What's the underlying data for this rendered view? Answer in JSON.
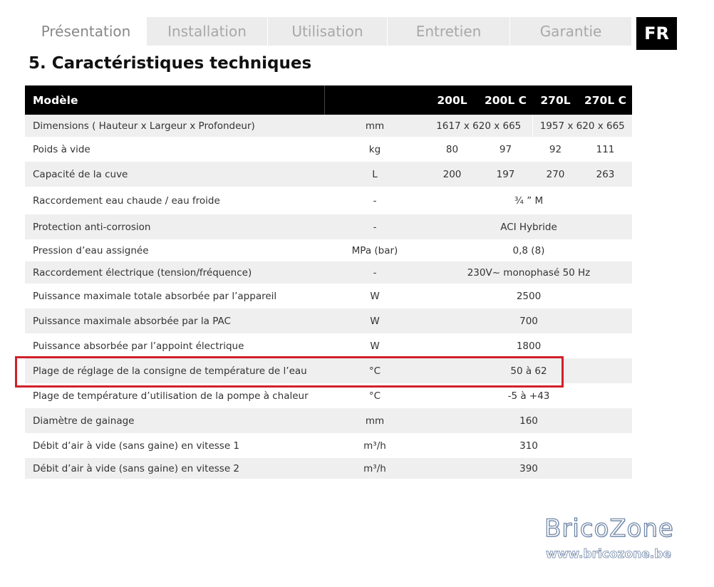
{
  "tabs": [
    {
      "label": "Présentation"
    },
    {
      "label": "Installation"
    },
    {
      "label": "Utilisation"
    },
    {
      "label": "Entretien"
    },
    {
      "label": "Garantie"
    }
  ],
  "language_badge": "FR",
  "section_title": "5. Caractéristiques techniques",
  "table": {
    "header": {
      "label": "Modèle",
      "unit": "",
      "models": [
        "200L",
        "200L C",
        "270L",
        "270L C"
      ]
    },
    "rows": [
      {
        "label": "Dimensions ( Hauteur x Largeur x Profondeur)",
        "unit": "mm",
        "value_a": "1617 x 620 x 665",
        "value_b": "1957 x 620 x 665"
      },
      {
        "label": "Poids à vide",
        "unit": "kg",
        "values": [
          "80",
          "97",
          "92",
          "111"
        ]
      },
      {
        "label": "Capacité de la cuve",
        "unit": "L",
        "values": [
          "200",
          "197",
          "270",
          "263"
        ]
      },
      {
        "label": "Raccordement eau chaude / eau froide",
        "unit": "-",
        "value": "¾ ” M"
      },
      {
        "label": "Protection anti-corrosion",
        "unit": "-",
        "value": "ACI Hybride"
      },
      {
        "label": "Pression d’eau assignée",
        "unit": "MPa (bar)",
        "value": "0,8 (8)"
      },
      {
        "label": "Raccordement électrique (tension/fréquence)",
        "unit": "-",
        "value": "230V~ monophasé 50 Hz"
      },
      {
        "label": "Puissance maximale totale absorbée par l’appareil",
        "unit": "W",
        "value": "2500"
      },
      {
        "label": "Puissance maximale absorbée par la PAC",
        "unit": "W",
        "value": "700"
      },
      {
        "label": "Puissance absorbée par l’appoint électrique",
        "unit": "W",
        "value": "1800"
      },
      {
        "label": "Plage de réglage de la consigne de température de l’eau",
        "unit": "°C",
        "value": "50 à 62"
      },
      {
        "label": "Plage de température d’utilisation de la pompe à chaleur",
        "unit": "°C",
        "value": "-5 à +43"
      },
      {
        "label": "Diamètre de gainage",
        "unit": "mm",
        "value": "160"
      },
      {
        "label": "Débit d’air à vide (sans gaine) en vitesse 1",
        "unit": "m³/h",
        "value": "310"
      },
      {
        "label": "Débit d’air à vide (sans gaine) en vitesse 2",
        "unit": "m³/h",
        "value": "390"
      }
    ]
  },
  "watermark": {
    "logo": "BricoZone",
    "url": "www.bricozone.be"
  },
  "colors": {
    "header_bg": "#000000",
    "row_alt": "#efefef",
    "highlight": "#d0202a"
  }
}
